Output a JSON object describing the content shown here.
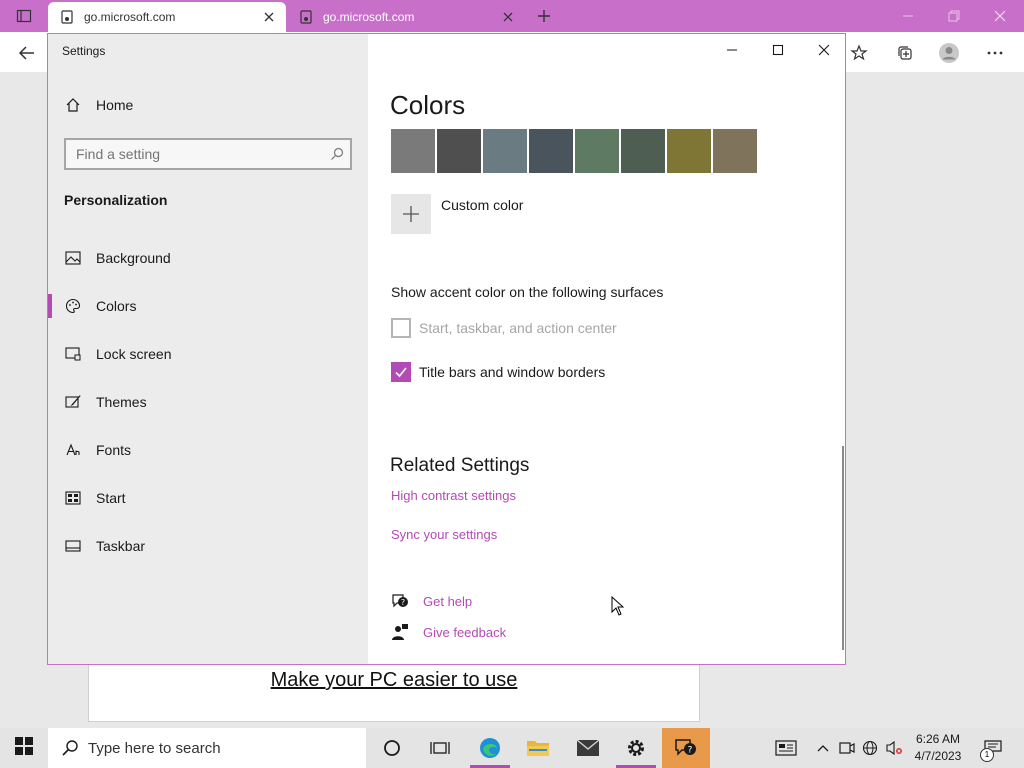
{
  "browser": {
    "tabs": [
      {
        "title": "go.microsoft.com",
        "active": true
      },
      {
        "title": "go.microsoft.com",
        "active": false
      }
    ],
    "accent": "#c86fc9"
  },
  "page": {
    "link_text": "Make your PC easier to use"
  },
  "settings": {
    "window_title": "Settings",
    "home_label": "Home",
    "search_placeholder": "Find a setting",
    "section": "Personalization",
    "nav_items": [
      {
        "label": "Background",
        "icon": "picture-icon"
      },
      {
        "label": "Colors",
        "icon": "palette-icon",
        "selected": true
      },
      {
        "label": "Lock screen",
        "icon": "lock-screen-icon"
      },
      {
        "label": "Themes",
        "icon": "brush-icon"
      },
      {
        "label": "Fonts",
        "icon": "font-icon"
      },
      {
        "label": "Start",
        "icon": "start-menu-icon"
      },
      {
        "label": "Taskbar",
        "icon": "taskbar-icon"
      }
    ],
    "main": {
      "title": "Colors",
      "swatches": [
        "#7a7a7a",
        "#4f4f4f",
        "#6b7b82",
        "#4a545c",
        "#5f7a62",
        "#4f5e52",
        "#7f7535",
        "#7f735c"
      ],
      "custom_color_label": "Custom color",
      "accent_heading": "Show accent color on the following surfaces",
      "checkbox_start": {
        "label": "Start, taskbar, and action center",
        "checked": false
      },
      "checkbox_titlebars": {
        "label": "Title bars and window borders",
        "checked": true
      },
      "related_heading": "Related Settings",
      "link_high_contrast": "High contrast settings",
      "link_sync": "Sync your settings",
      "get_help": "Get help",
      "give_feedback": "Give feedback"
    },
    "accent": "#b34ab5"
  },
  "taskbar": {
    "search_placeholder": "Type here to search",
    "time": "6:26 AM",
    "date": "4/7/2023",
    "notification_count": "1"
  }
}
